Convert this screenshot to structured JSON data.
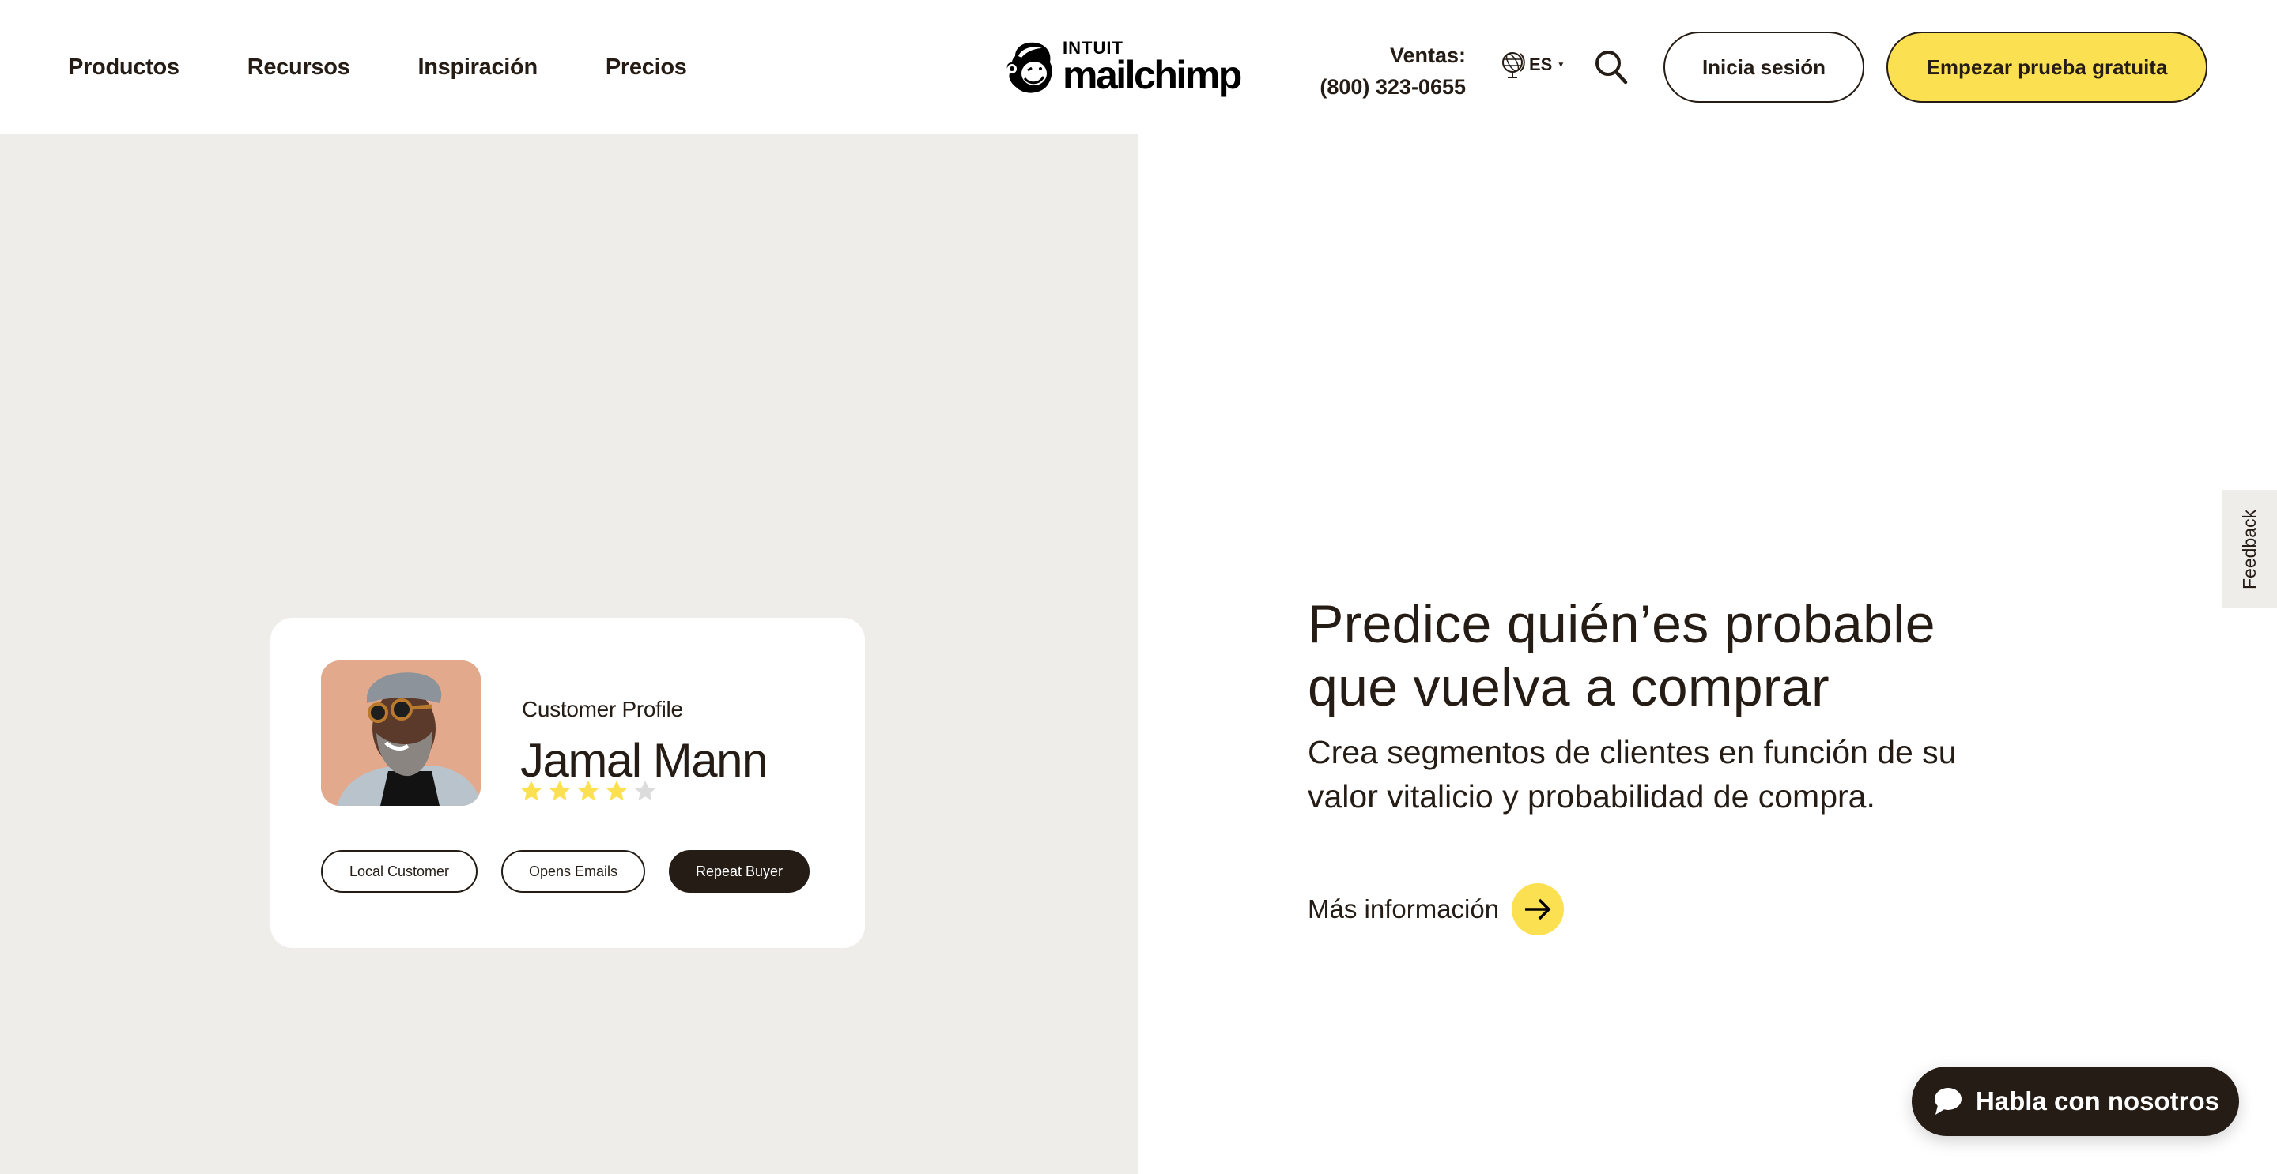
{
  "header": {
    "nav": [
      {
        "label": "Productos"
      },
      {
        "label": "Recursos"
      },
      {
        "label": "Inspiración"
      },
      {
        "label": "Precios"
      }
    ],
    "logo": {
      "intuit": "INTUIT",
      "brand": "mailchimp"
    },
    "sales": {
      "label": "Ventas:",
      "phone": "(800) 323-0655"
    },
    "language": {
      "code": "ES",
      "icon": "globe-icon"
    },
    "search_icon": "search-icon",
    "login_label": "Inicia sesión",
    "trial_label": "Empezar prueba gratuita"
  },
  "profile_card": {
    "label": "Customer Profile",
    "name": "Jamal Mann",
    "rating": 4,
    "rating_max": 5,
    "tags": [
      {
        "label": "Local Customer",
        "active": false
      },
      {
        "label": "Opens Emails",
        "active": false
      },
      {
        "label": "Repeat Buyer",
        "active": true
      }
    ]
  },
  "feature": {
    "headline_line1": "Predice quién’es probable",
    "headline_line2": "que vuelva a comprar",
    "subtext_line1": "Crea segmentos de clientes en función de su",
    "subtext_line2": "valor vitalicio y probabilidad de compra.",
    "link_label": "Más información"
  },
  "feedback_label": "Feedback",
  "chat": {
    "label": "Habla con nosotros",
    "icon": "chat-bubble-icon"
  },
  "colors": {
    "accent_yellow": "#fbe052",
    "text_dark": "#241c15",
    "panel_gray": "#eeede9",
    "star_filled": "#fbe052",
    "star_empty": "#dcdcdc"
  }
}
